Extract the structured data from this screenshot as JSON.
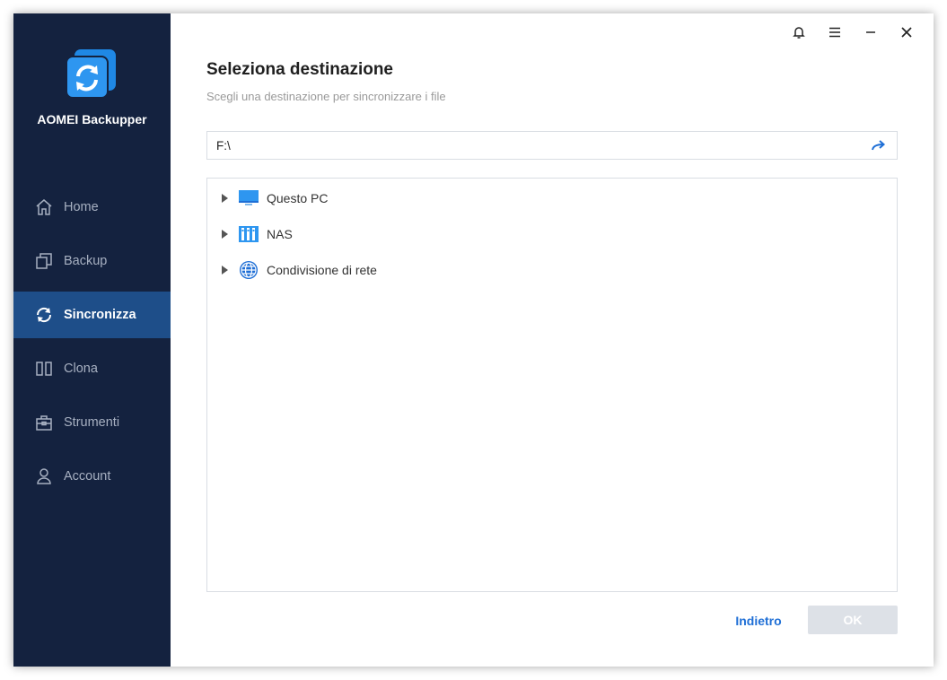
{
  "app": {
    "name": "AOMEI Backupper"
  },
  "sidebar": {
    "items": [
      {
        "label": "Home",
        "icon": "home-icon",
        "active": false
      },
      {
        "label": "Backup",
        "icon": "backup-icon",
        "active": false
      },
      {
        "label": "Sincronizza",
        "icon": "sync-icon",
        "active": true
      },
      {
        "label": "Clona",
        "icon": "clone-icon",
        "active": false
      },
      {
        "label": "Strumenti",
        "icon": "tools-icon",
        "active": false
      },
      {
        "label": "Account",
        "icon": "account-icon",
        "active": false
      }
    ]
  },
  "titlebar": {
    "icons": [
      "bell-icon",
      "menu-icon",
      "minimize-icon",
      "close-icon"
    ]
  },
  "page": {
    "title": "Seleziona destinazione",
    "subtitle": "Scegli una destinazione per sincronizzare i file"
  },
  "path": {
    "value": "F:\\"
  },
  "tree": {
    "items": [
      {
        "label": "Questo PC",
        "icon": "monitor-icon"
      },
      {
        "label": "NAS",
        "icon": "nas-icon"
      },
      {
        "label": "Condivisione di rete",
        "icon": "network-share-icon"
      }
    ]
  },
  "footer": {
    "back_label": "Indietro",
    "ok_label": "OK"
  },
  "colors": {
    "sidebar_bg": "#14223f",
    "active_bg": "#1e4e89",
    "accent": "#1f6fd6",
    "ok_disabled": "#dde1e7"
  }
}
